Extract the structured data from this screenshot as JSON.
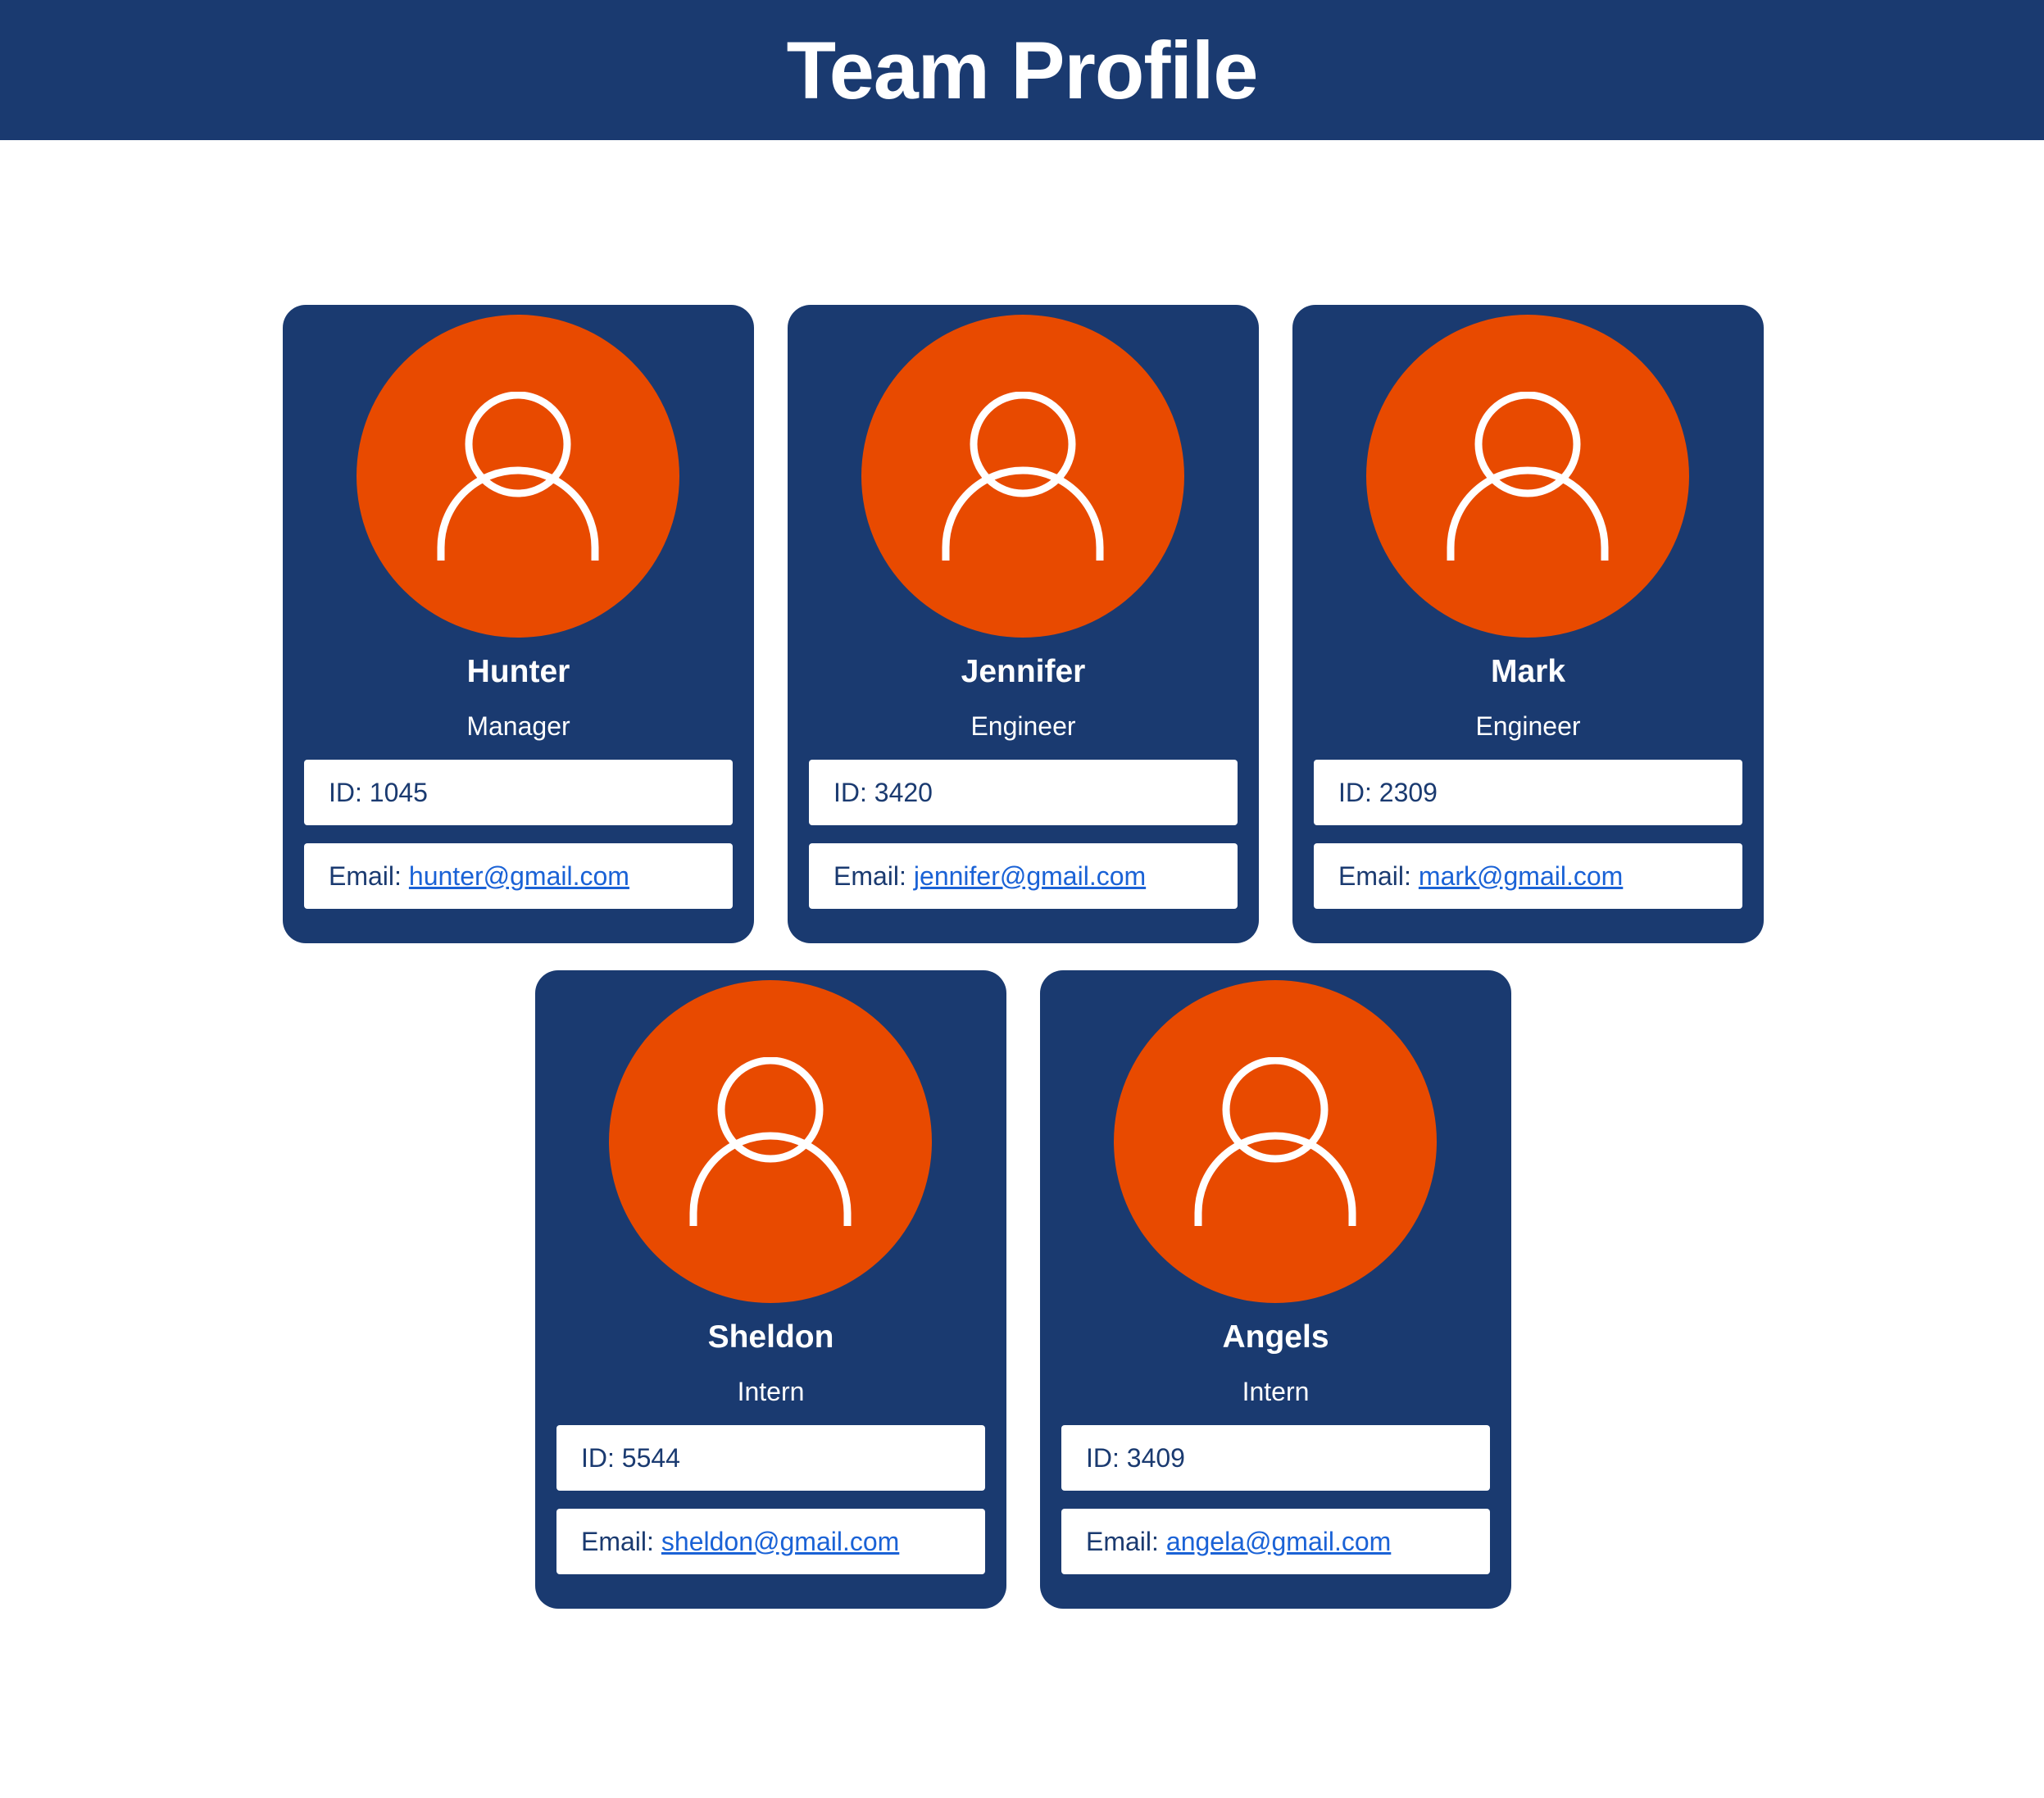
{
  "header": {
    "title": "Team Profile"
  },
  "labels": {
    "id_prefix": "ID:",
    "email_prefix": "Email:"
  },
  "colors": {
    "header_bg": "#1a3a70",
    "card_bg": "#1a3a70",
    "avatar_bg": "#e84a00",
    "link": "#1a62d6"
  },
  "avatar_icon": "user-outline-icon",
  "employees": [
    {
      "name": "Hunter",
      "role": "Manager",
      "id": "1045",
      "email": "hunter@gmail.com"
    },
    {
      "name": "Jennifer",
      "role": "Engineer",
      "id": "3420",
      "email": "jennifer@gmail.com"
    },
    {
      "name": "Mark",
      "role": "Engineer",
      "id": "2309",
      "email": "mark@gmail.com"
    },
    {
      "name": "Sheldon",
      "role": "Intern",
      "id": "5544",
      "email": "sheldon@gmail.com"
    },
    {
      "name": "Angels",
      "role": "Intern",
      "id": "3409",
      "email": "angela@gmail.com"
    }
  ]
}
